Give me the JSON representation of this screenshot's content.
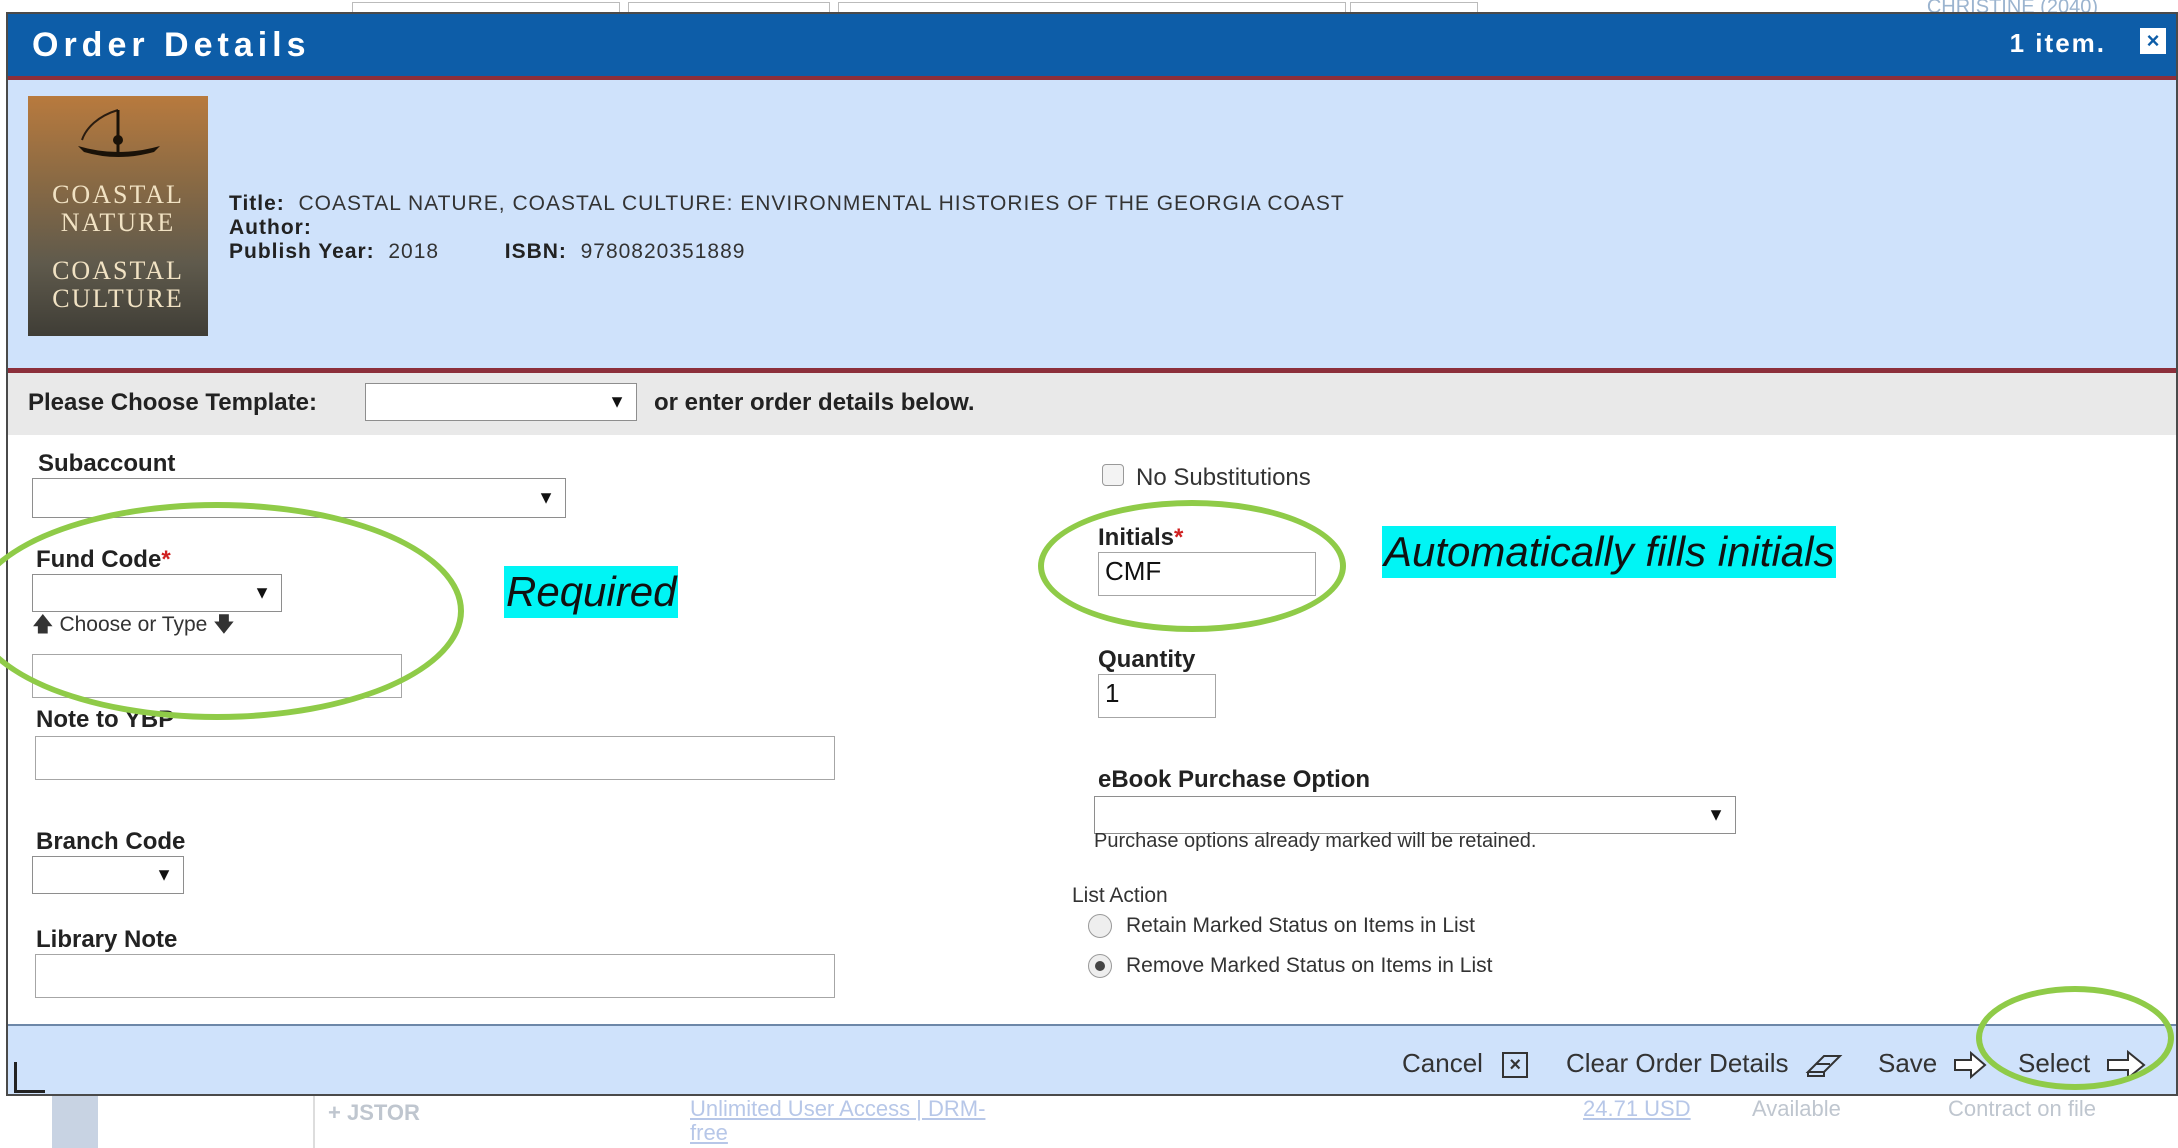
{
  "background": {
    "top_link": "CHRISTINE (2040)",
    "vendor": "+ JSTOR",
    "access": "Unlimited User Access | DRM-",
    "access2": "free",
    "price": "24.71 USD",
    "status": "Available",
    "contract": "Contract on file"
  },
  "dialog": {
    "title": "Order Details",
    "item_count": "1 item.",
    "close": "×"
  },
  "book": {
    "cover": {
      "line1": "COASTAL",
      "line2": "NATURE",
      "line3": "COASTAL",
      "line4": "CULTURE"
    },
    "title_label": "Title:",
    "title": "COASTAL NATURE, COASTAL CULTURE: ENVIRONMENTAL HISTORIES OF THE GEORGIA COAST",
    "author_label": "Author:",
    "year_label": "Publish Year:",
    "year": "2018",
    "isbn_label": "ISBN:",
    "isbn": "9780820351889"
  },
  "template": {
    "label": "Please Choose Template:",
    "selected": "",
    "suffix": "or enter order details below."
  },
  "form": {
    "subaccount_label": "Subaccount",
    "fund_code_label": "Fund Code",
    "required_star": "*",
    "choose_or_type": "Choose or Type",
    "fund_code_text": "",
    "note_ybp_label": "Note to YBP",
    "branch_code_label": "Branch Code",
    "library_note_label": "Library Note",
    "no_substitutions_label": "No Substitutions",
    "initials_label": "Initials",
    "initials_value": "CMF",
    "quantity_label": "Quantity",
    "quantity_value": "1",
    "ebook_label": "eBook Purchase Option",
    "ebook_note": "Purchase options already marked will be retained.",
    "list_action_label": "List Action",
    "retain_label": "Retain Marked Status on Items in List",
    "remove_label": "Remove Marked Status on Items in List"
  },
  "annotations": {
    "required": "Required",
    "auto_initials": "Automatically fills initials"
  },
  "footer": {
    "cancel": "Cancel",
    "clear": "Clear Order Details",
    "save": "Save",
    "select": "Select"
  },
  "icons": {
    "close": "close-icon",
    "cancel": "cancel-x-icon",
    "clear": "eraser-icon",
    "save": "arrow-right-icon",
    "select": "arrow-right-icon"
  },
  "colors": {
    "title_bar": "#0d5da8",
    "panel": "#cfe2fb",
    "accent_border": "#8c2f3b",
    "highlight": "#00f5f5",
    "ellipse": "#8fcb48",
    "required": "#d02020"
  }
}
